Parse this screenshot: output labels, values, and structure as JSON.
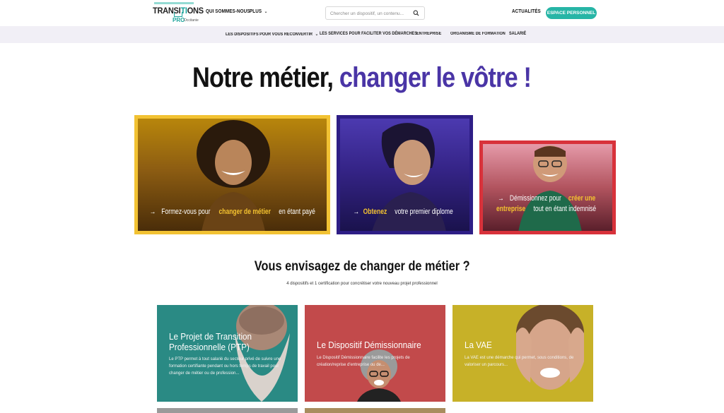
{
  "header": {
    "logo": {
      "word_pre": "TRANSI",
      "word_ti": "TI",
      "word_post": "ONS",
      "pro": "PRO",
      "region": "Occitanie"
    },
    "nav": [
      {
        "label": "QUI SOMMES-NOUS"
      },
      {
        "label": "PLUS"
      }
    ],
    "search_placeholder": "Chercher un dispositif, un contenu...",
    "actualites": "ACTUALITÉS",
    "espace_personnel": "ESPACE PERSONNEL",
    "accent_color": "#27b5a6"
  },
  "subnav": [
    {
      "label": "LES DISPOSITIFS POUR VOUS RECONVERTIR"
    },
    {
      "label": "LES SERVICES POUR FACILITER VOS DÉMARCHES"
    },
    {
      "label": "ENTREPRISE"
    },
    {
      "label": "ORGANISME DE FORMATION"
    },
    {
      "label": "SALARIÉ"
    }
  ],
  "hero": {
    "title_plain": "Notre métier,",
    "title_highlight": "changer le vôtre !",
    "highlight_color": "#4a35a6",
    "cards": [
      {
        "arrow": "→",
        "pre": "Formez-vous pour",
        "highlight": "changer de métier",
        "post": "en étant payé",
        "border_color": "#f2c233"
      },
      {
        "arrow": "→",
        "pre": "",
        "highlight": "Obtenez",
        "post": "votre premier diplome",
        "border_color": "#2e1e86"
      },
      {
        "arrow": "→",
        "pre": "Démissionnez pour",
        "highlight": "créer une",
        "line2_highlight": "entreprise",
        "post": "tout en étant indemnisé",
        "border_color": "#d8323b"
      }
    ]
  },
  "section": {
    "title": "Vous envisagez de changer de métier ?",
    "subtitle": "4 dispositifs et 1 certification pour concrétiser votre nouveau projet professionnel",
    "cards": [
      {
        "title_line1": "Le Projet de Transition",
        "title_line2": "Professionnelle (PTP)",
        "desc": "Le PTP permet à tout salarié du secteur privé de suivre une formation certifiante pendant ou hors temps de travail pour changer de métier ou de profession...",
        "color": "#2a8a84"
      },
      {
        "title_line1": "Le Dispositif Démissionnaire",
        "title_line2": "",
        "desc": "Le Dispositif Démissionnaire facilite les projets de création/reprise d'entreprise ou de...",
        "color": "#c24a4b"
      },
      {
        "title_line1": "La VAE",
        "title_line2": "",
        "desc": "La VAE est une démarche qui permet, sous conditions, de valoriser un parcours...",
        "color": "#c7b128"
      }
    ]
  }
}
